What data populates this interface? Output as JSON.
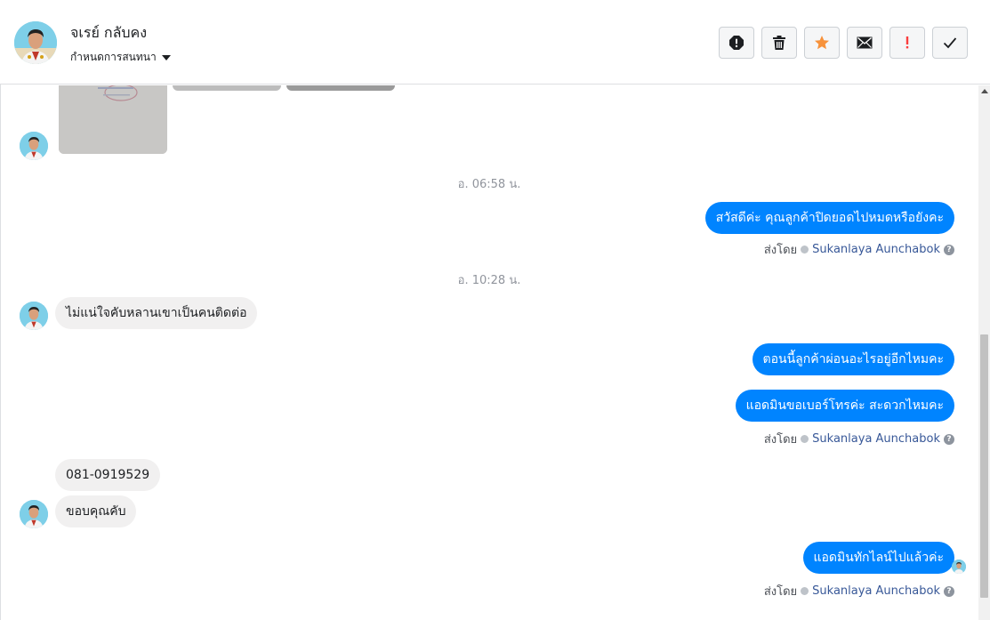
{
  "header": {
    "contact_name": "จเรย์ กลับคง",
    "subtitle": "กำหนดการสนทนา",
    "actions": [
      {
        "label": "spam",
        "icon": "alert-circle-icon"
      },
      {
        "label": "delete",
        "icon": "trash-icon"
      },
      {
        "label": "star",
        "icon": "star-icon",
        "color": "#f7923b"
      },
      {
        "label": "mark-unread",
        "icon": "envelope-icon"
      },
      {
        "label": "important",
        "icon": "exclamation-icon",
        "color": "#fa3e3e"
      },
      {
        "label": "done",
        "icon": "checkmark-icon"
      }
    ]
  },
  "messages": {
    "time_1": "อ. 06:58 น.",
    "out_1": "สวัสดีค่ะ คุณลูกค้าปิดยอดไปหมดหรือยังคะ",
    "time_2": "อ. 10:28 น.",
    "in_1": "ไม่แน่ใจคับหลานเขาเป็นคนติดต่อ",
    "out_2": "ตอนนี้ลูกค้าผ่อนอะไรอยู่อีกไหมคะ",
    "out_3": "แอดมินขอเบอร์โทรค่ะ สะดวกไหมคะ",
    "in_2": "081-0919529",
    "in_3": "ขอบคุณคับ",
    "out_4": "แอดมินทักไลน์ไปแล้วค่ะ"
  },
  "sent_by": {
    "prefix": "ส่งโดย",
    "agent": "Sukanlaya Aunchabok",
    "help": "?"
  },
  "colors": {
    "outgoing_bubble": "#0084ff",
    "incoming_bubble": "#f1f0f0",
    "link": "#385898"
  }
}
